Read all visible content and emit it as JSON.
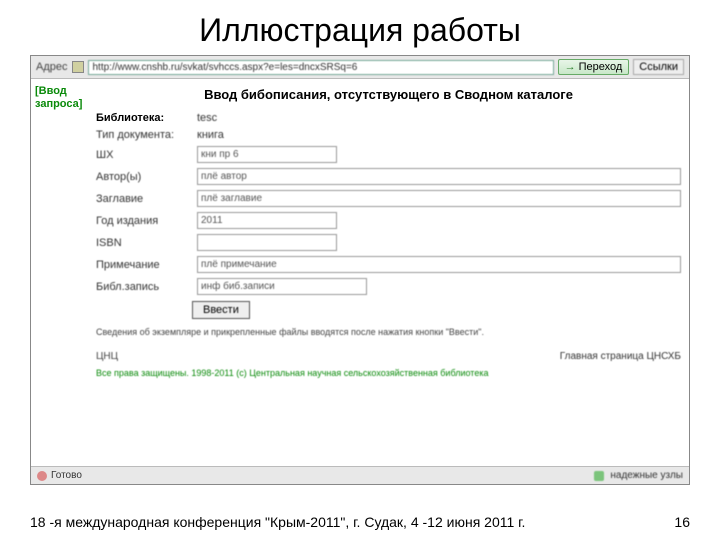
{
  "slide": {
    "title": "Иллюстрация работы",
    "footer_text": "18 -я международная конференция \"Крым-2011\", г. Судак, 4 -12 июня 2011 г.",
    "page_number": "16"
  },
  "browser": {
    "address_label": "Адрес",
    "url": "http://www.cnshb.ru/svkat/svhccs.aspx?e=les=dncxSRSq=6",
    "go_label": "Переход",
    "links_label": "Ссылки"
  },
  "sidebar": {
    "link_line1": "[Ввод",
    "link_line2": "запроса]"
  },
  "form": {
    "header": "Ввод бибописания, отсутствующего в Сводном каталоге",
    "rows": [
      {
        "label": "Библиотека:",
        "value": "tesс",
        "type": "readonly",
        "strong": true
      },
      {
        "label": "Тип документа:",
        "value": "книга",
        "type": "readonly"
      },
      {
        "label": "ШХ",
        "value": "кни пр 6",
        "type": "short"
      },
      {
        "label": "Автор(ы)",
        "value": "плё автор",
        "type": "full"
      },
      {
        "label": "Заглавие",
        "value": "плё заглавие",
        "type": "full"
      },
      {
        "label": "Год издания",
        "value": "2011",
        "type": "short"
      },
      {
        "label": "ISBN",
        "value": "",
        "type": "short"
      },
      {
        "label": "Примечание",
        "value": "плё примечание",
        "type": "full"
      },
      {
        "label": "Библ.запись",
        "value": "инф биб.записи",
        "type": "med"
      }
    ],
    "submit": "Ввести",
    "note": "Сведения об экземпляре и прикрепленные файлы вводятся после нажатия кнопки \"Ввести\"."
  },
  "page_footer": {
    "left": "ЦНЦ",
    "right": "Главная страница ЦНСХБ",
    "copyright": "Все права защищены. 1998-2011 (с) Центральная научная сельскохозяйственная библиотека"
  },
  "statusbar": {
    "left": "Готово",
    "zone": "надежные узлы"
  }
}
